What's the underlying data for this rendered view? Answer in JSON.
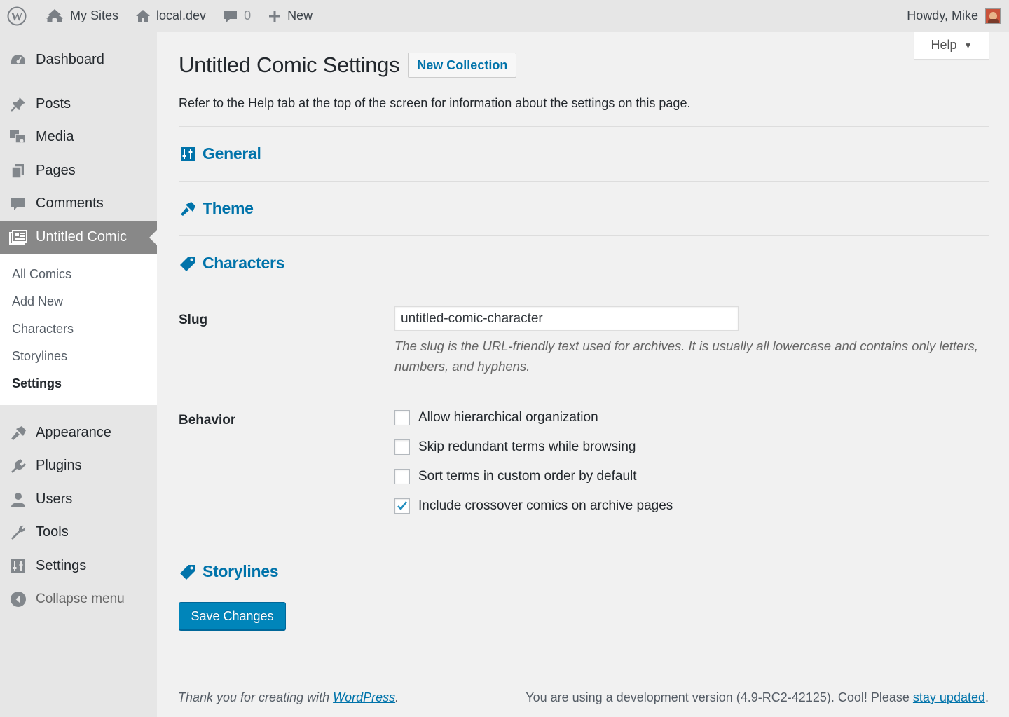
{
  "adminbar": {
    "my_sites": "My Sites",
    "site_name": "local.dev",
    "comments_count": "0",
    "new_label": "New",
    "greeting": "Howdy, Mike"
  },
  "sidebar": {
    "items": [
      {
        "label": "Dashboard",
        "icon": "dashboard-icon"
      },
      {
        "label": "Posts",
        "icon": "pin-icon"
      },
      {
        "label": "Media",
        "icon": "media-icon"
      },
      {
        "label": "Pages",
        "icon": "pages-icon"
      },
      {
        "label": "Comments",
        "icon": "comment-icon"
      },
      {
        "label": "Untitled Comic",
        "icon": "comic-icon"
      },
      {
        "label": "Appearance",
        "icon": "brush-icon"
      },
      {
        "label": "Plugins",
        "icon": "plug-icon"
      },
      {
        "label": "Users",
        "icon": "user-icon"
      },
      {
        "label": "Tools",
        "icon": "wrench-icon"
      },
      {
        "label": "Settings",
        "icon": "sliders-icon"
      }
    ],
    "submenu": [
      "All Comics",
      "Add New",
      "Characters",
      "Storylines",
      "Settings"
    ],
    "collapse": "Collapse menu"
  },
  "header": {
    "title": "Untitled Comic Settings",
    "new_collection": "New Collection",
    "help": "Help",
    "intro": "Refer to the Help tab at the top of the screen for information about the settings on this page."
  },
  "sections": {
    "general": "General",
    "theme": "Theme",
    "characters": "Characters",
    "storylines": "Storylines"
  },
  "characters": {
    "slug_label": "Slug",
    "slug_value": "untitled-comic-character",
    "slug_desc": "The slug is the URL-friendly text used for archives. It is usually all lowercase and contains only letters, numbers, and hyphens.",
    "behavior_label": "Behavior",
    "options": [
      {
        "label": "Allow hierarchical organization",
        "checked": false
      },
      {
        "label": "Skip redundant terms while browsing",
        "checked": false
      },
      {
        "label": "Sort terms in custom order by default",
        "checked": false
      },
      {
        "label": "Include crossover comics on archive pages",
        "checked": true
      }
    ]
  },
  "save_label": "Save Changes",
  "footer": {
    "thanks_prefix": "Thank you for creating with ",
    "thanks_link": "WordPress",
    "thanks_suffix": ".",
    "version_text": "You are using a development version (4.9-RC2-42125). Cool! Please ",
    "version_link": "stay updated",
    "version_suffix": "."
  },
  "colors": {
    "accent": "#0073aa",
    "primary_button": "#0085ba",
    "current_menu": "#888888"
  }
}
